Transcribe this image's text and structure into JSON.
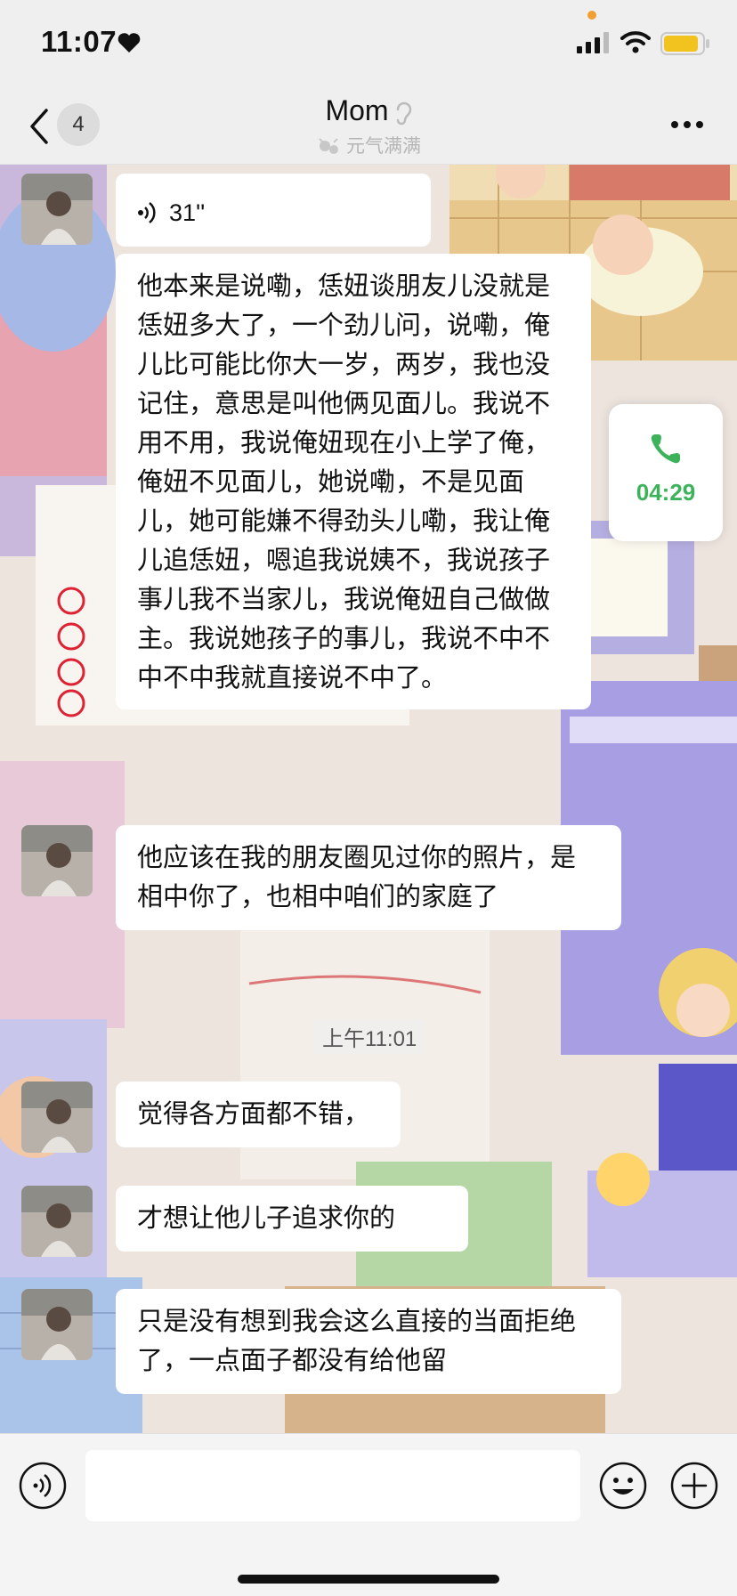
{
  "status_bar": {
    "time": "11:07"
  },
  "nav": {
    "badge_count": "4",
    "title": "Mom",
    "subtitle": "元气满满"
  },
  "call_widget": {
    "duration": "04:29"
  },
  "chat": {
    "timestamp": "上午11:01",
    "messages": [
      {
        "type": "voice",
        "duration": "31''"
      },
      {
        "type": "text",
        "text": "他本来是说嘞，恁妞谈朋友儿没就是恁妞多大了，一个劲儿问，说嘞，俺儿比可能比你大一岁，两岁，我也没记住，意思是叫他俩见面儿。我说不用不用，我说俺妞现在小上学了俺，俺妞不见面儿，她说嘞，不是见面儿，她可能嫌不得劲头儿嘞，我让俺儿追恁妞，嗯追我说姨不，我说孩子事儿我不当家儿，我说俺妞自己做做主。我说她孩子的事儿，我说不中不中不中我就直接说不中了。"
      },
      {
        "type": "text",
        "text": "他应该在我的朋友圈见过你的照片，是相中你了，也相中咱们的家庭了"
      },
      {
        "type": "text",
        "text": "觉得各方面都不错，"
      },
      {
        "type": "text",
        "text": "才想让他儿子追求你的"
      },
      {
        "type": "text",
        "text": "只是没有想到我会这么直接的当面拒绝了，一点面子都没有给他留"
      }
    ]
  },
  "colors": {
    "accent_green": "#3cb35a",
    "bubble": "#ffffff"
  }
}
